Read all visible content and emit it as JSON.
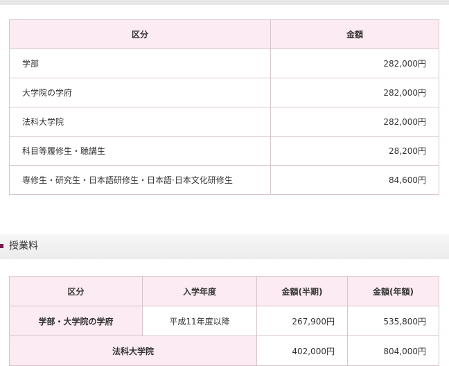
{
  "fees_table": {
    "headers": {
      "category": "区分",
      "amount": "金額"
    },
    "rows": [
      {
        "category": "学部",
        "amount": "282,000円"
      },
      {
        "category": "大学院の学府",
        "amount": "282,000円"
      },
      {
        "category": "法科大学院",
        "amount": "282,000円"
      },
      {
        "category": "科目等履修生・聴講生",
        "amount": "28,200円"
      },
      {
        "category": "専修生・研究生・日本語研修生・日本語·日本文化研修生",
        "amount": "84,600円"
      }
    ]
  },
  "tuition_section": {
    "title": "授業料"
  },
  "tuition_table": {
    "headers": {
      "category": "区分",
      "entry_year": "入学年度",
      "half_year": "金額(半期)",
      "full_year": "金額(年額)"
    },
    "rows": [
      {
        "category": "学部・大学院の学府",
        "entry_year": "平成11年度以降",
        "half_year": "267,900円",
        "full_year": "535,800円"
      },
      {
        "category": "法科大学院",
        "half_year": "402,000円",
        "full_year": "804,000円"
      }
    ]
  }
}
